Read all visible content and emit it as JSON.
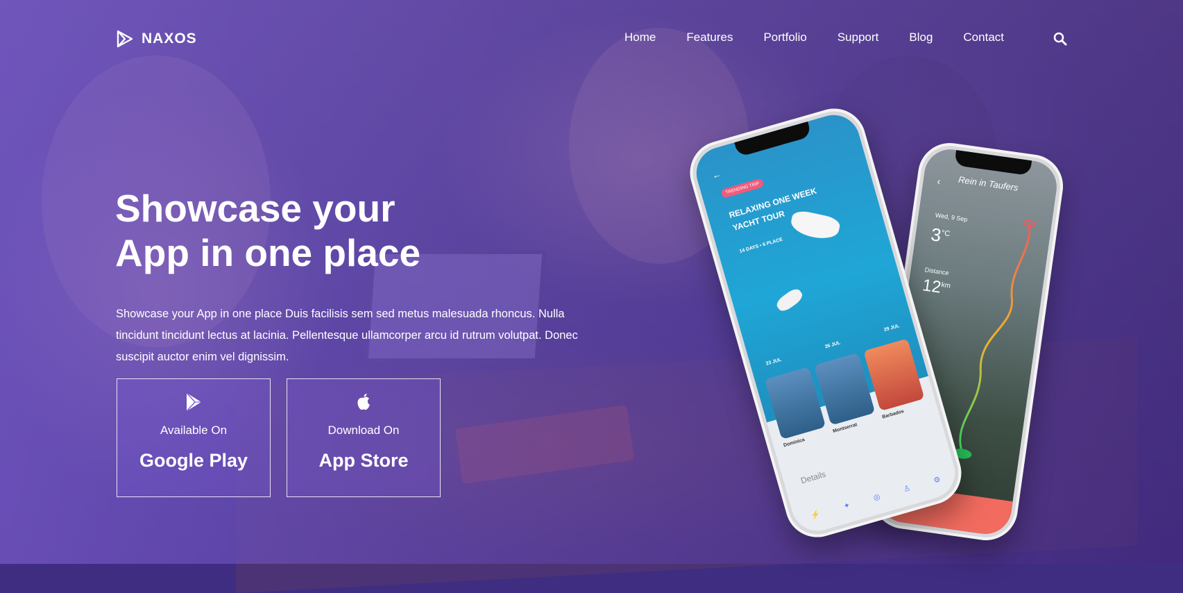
{
  "brand": {
    "name": "NAXOS"
  },
  "nav": {
    "items": [
      {
        "label": "Home"
      },
      {
        "label": "Features"
      },
      {
        "label": "Portfolio"
      },
      {
        "label": "Support"
      },
      {
        "label": "Blog"
      },
      {
        "label": "Contact"
      }
    ],
    "search_icon": "search-icon"
  },
  "hero": {
    "headline_line1": "Showcase your",
    "headline_line2": "App in one place",
    "lead": "Showcase your App in one place Duis facilisis sem sed metus malesuada rhoncus. Nulla tincidunt tincidunt lectus at lacinia. Pellentesque ullamcorper arcu id rutrum volutpat. Donec suscipit auctor enim vel dignissim."
  },
  "store_buttons": [
    {
      "icon": "google-play-icon",
      "small": "Available On",
      "big": "Google Play"
    },
    {
      "icon": "apple-icon",
      "small": "Download On",
      "big": "App Store"
    }
  ],
  "phone_back": {
    "title": "Rein in Taufers",
    "date": "Wed, 9 Sep",
    "temp": "3",
    "temp_unit": "°C",
    "distance_label": "Distance",
    "distance": "12",
    "distance_unit": "km"
  },
  "phone_front": {
    "badge": "TRENDING TRIP",
    "title": "RELAXING ONE WEEK YACHT TOUR",
    "subtitle": "14 DAYS • 6 PLACE",
    "dates": [
      "23 JUL",
      "26 JUL",
      "29 JUL"
    ],
    "cards": [
      "Dominica",
      "Montserrat",
      "Barbados"
    ],
    "details": "Details"
  },
  "colors": {
    "overlay": "#7a5ad2",
    "accent_coral": "#f26b5f"
  }
}
